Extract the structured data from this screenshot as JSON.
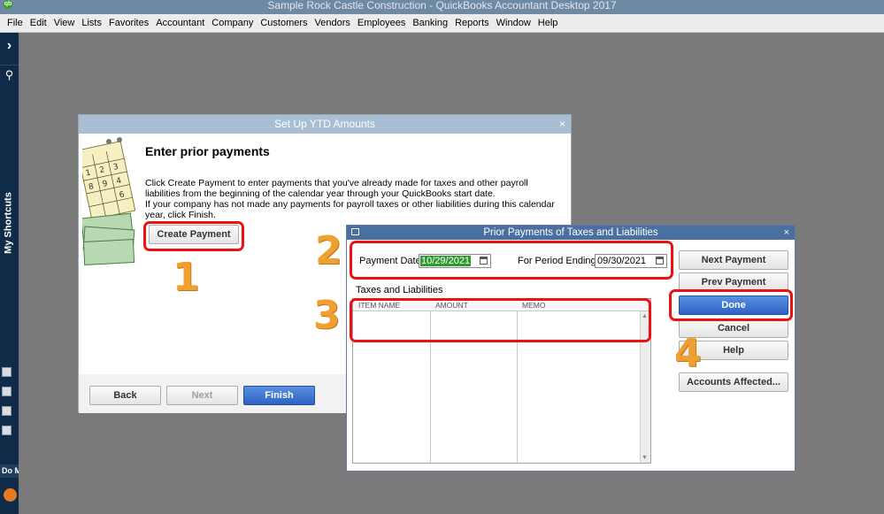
{
  "window": {
    "title": "Sample Rock Castle Construction  - QuickBooks Accountant Desktop 2017",
    "logo_text": "qb"
  },
  "menu": [
    {
      "label": "File"
    },
    {
      "label": "Edit"
    },
    {
      "label": "View"
    },
    {
      "label": "Lists"
    },
    {
      "label": "Favorites"
    },
    {
      "label": "Accountant"
    },
    {
      "label": "Company"
    },
    {
      "label": "Customers"
    },
    {
      "label": "Vendors"
    },
    {
      "label": "Employees"
    },
    {
      "label": "Banking"
    },
    {
      "label": "Reports"
    },
    {
      "label": "Window"
    },
    {
      "label": "Help"
    }
  ],
  "sidebar": {
    "expand_glyph": "›",
    "search_glyph": "⚲",
    "shortcuts_label": "My Shortcuts",
    "do_label": "Do M"
  },
  "ytd_dialog": {
    "title": "Set Up YTD Amounts",
    "close_glyph": "×",
    "heading": "Enter prior payments",
    "para1": "Click Create Payment to enter payments that you've already made for taxes and other payroll liabilities from the beginning of the calendar year through your QuickBooks start date.",
    "para2": "If your company has not made any payments for payroll taxes or other liabilities during this calendar year, click Finish.",
    "create_payment_label": "Create Payment",
    "back_label": "Back",
    "next_label": "Next",
    "finish_label": "Finish"
  },
  "prior_dialog": {
    "title": "Prior Payments of Taxes and Liabilities",
    "close_glyph": "×",
    "payment_date_label": "Payment Date",
    "payment_date_value": "10/29/2021",
    "period_ending_label": "For Period Ending",
    "period_ending_value": "09/30/2021",
    "section_label": "Taxes and Liabilities",
    "columns": [
      "ITEM NAME",
      "AMOUNT",
      "MEMO"
    ],
    "buttons": {
      "next_payment": "Next Payment",
      "prev_payment": "Prev Payment",
      "done": "Done",
      "cancel": "Cancel",
      "help": "Help",
      "accounts_affected": "Accounts Affected..."
    }
  },
  "annotations": {
    "color": "#ee1111",
    "number_color": "#f0a030",
    "labels": [
      "1",
      "2",
      "3",
      "4"
    ]
  }
}
